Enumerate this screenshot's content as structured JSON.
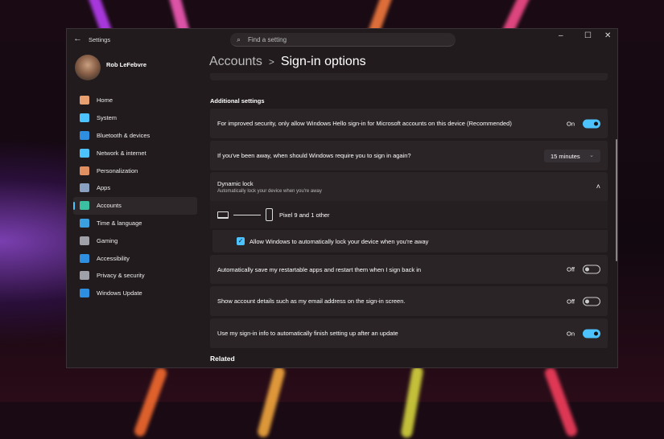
{
  "window": {
    "title": "Settings",
    "search_placeholder": "Find a setting"
  },
  "user": {
    "name": "Rob LeFebvre"
  },
  "nav": [
    {
      "label": "Home",
      "icon": "home-icon",
      "color": "#e8a070"
    },
    {
      "label": "System",
      "icon": "system-icon",
      "color": "#4cc2ff"
    },
    {
      "label": "Bluetooth & devices",
      "icon": "bluetooth-icon",
      "color": "#2e8fe0"
    },
    {
      "label": "Network & internet",
      "icon": "wifi-icon",
      "color": "#4cc2ff"
    },
    {
      "label": "Personalization",
      "icon": "brush-icon",
      "color": "#e09060"
    },
    {
      "label": "Apps",
      "icon": "apps-icon",
      "color": "#8aa0c0"
    },
    {
      "label": "Accounts",
      "icon": "accounts-icon",
      "color": "#3ac0a0"
    },
    {
      "label": "Time & language",
      "icon": "time-language-icon",
      "color": "#3aa0e0"
    },
    {
      "label": "Gaming",
      "icon": "gaming-icon",
      "color": "#a0a0a8"
    },
    {
      "label": "Accessibility",
      "icon": "accessibility-icon",
      "color": "#2e8fe0"
    },
    {
      "label": "Privacy & security",
      "icon": "shield-icon",
      "color": "#a0a0a8"
    },
    {
      "label": "Windows Update",
      "icon": "windows-update-icon",
      "color": "#2e8fe0"
    }
  ],
  "active_nav": "Accounts",
  "breadcrumb": {
    "parent": "Accounts",
    "current": "Sign-in options"
  },
  "section_title": "Additional settings",
  "settings": {
    "hello_only": {
      "label": "For improved security, only allow Windows Hello sign-in for Microsoft accounts on this device (Recommended)",
      "state": "On"
    },
    "require_signin": {
      "label": "If you've been away, when should Windows require you to sign in again?",
      "value": "15 minutes"
    },
    "dynamic_lock": {
      "title": "Dynamic lock",
      "subtitle": "Automatically lock your device when you're away",
      "device": "Pixel 9 and 1 other",
      "checkbox": "Allow Windows to automatically lock your device when you're away",
      "checked": true
    },
    "restart_apps": {
      "label": "Automatically save my restartable apps and restart them when I sign back in",
      "state": "Off"
    },
    "account_details": {
      "label": "Show account details such as my email address on the sign-in screen.",
      "state": "Off"
    },
    "signin_info": {
      "label": "Use my sign-in info to automatically finish setting up after an update",
      "state": "On"
    }
  },
  "related_title": "Related",
  "accent": "#4cc2ff"
}
